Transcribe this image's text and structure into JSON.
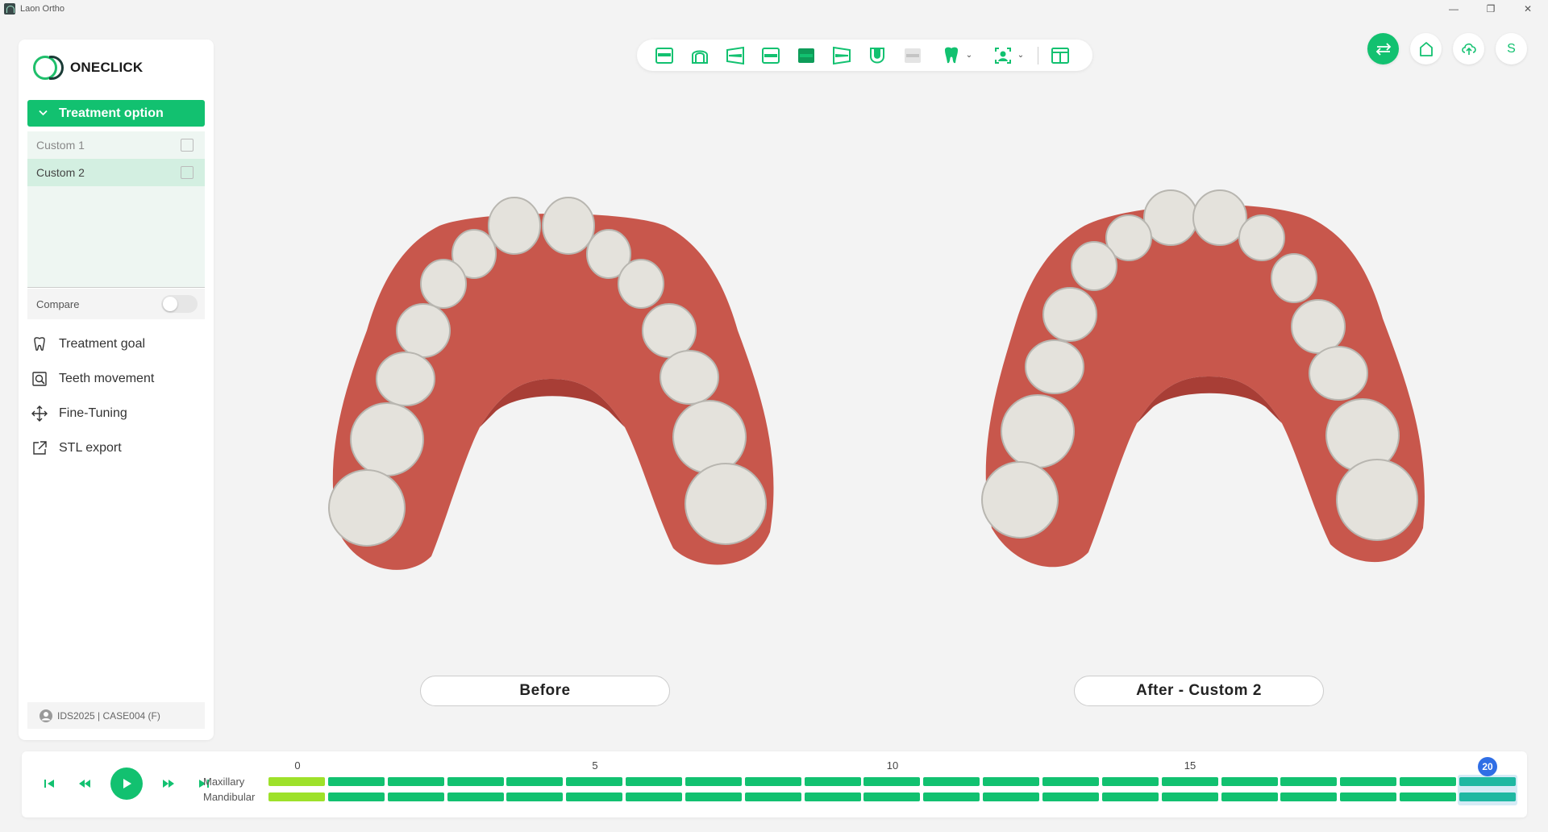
{
  "window": {
    "title": "Laon Ortho",
    "minimize": "—",
    "maximize": "❐",
    "close": "✕"
  },
  "sidebar": {
    "logo_text": "ONECLICK",
    "treatment_option_label": "Treatment option",
    "options": [
      {
        "label": "Custom 1",
        "selected": false
      },
      {
        "label": "Custom 2",
        "selected": true
      }
    ],
    "compare_label": "Compare",
    "compare_on": false,
    "menu": [
      {
        "label": "Treatment goal",
        "icon": "tooth-icon"
      },
      {
        "label": "Teeth movement",
        "icon": "magnify-tooth-icon"
      },
      {
        "label": "Fine-Tuning",
        "icon": "move-arrows-icon"
      },
      {
        "label": "STL export",
        "icon": "export-icon"
      }
    ],
    "case_info": "IDS2025 | CASE004 (F)"
  },
  "toolbar": {
    "buttons": [
      "front-view-icon",
      "arch-view-icon",
      "left-view-icon",
      "top-view-icon",
      "bottom-view-icon",
      "right-view-icon",
      "occlusal-view-icon",
      "hide-view-icon",
      "tooth-menu-icon",
      "face-menu-icon",
      "layout-icon"
    ]
  },
  "topright": {
    "user_initial": "S"
  },
  "views": {
    "before_label": "Before",
    "after_label": "After - Custom 2"
  },
  "timeline": {
    "maxillary_label": "Maxillary",
    "mandibular_label": "Mandibular",
    "tick_labels": [
      "0",
      "5",
      "10",
      "15"
    ],
    "current_stage": "20",
    "total_stages": 21
  },
  "colors": {
    "accent": "#12c170",
    "stage_first": "#9ee12a",
    "stage_current": "#1fb8a2",
    "badge": "#2f6ee5",
    "gum": "#c8574c",
    "tooth": "#e4e2dc"
  }
}
